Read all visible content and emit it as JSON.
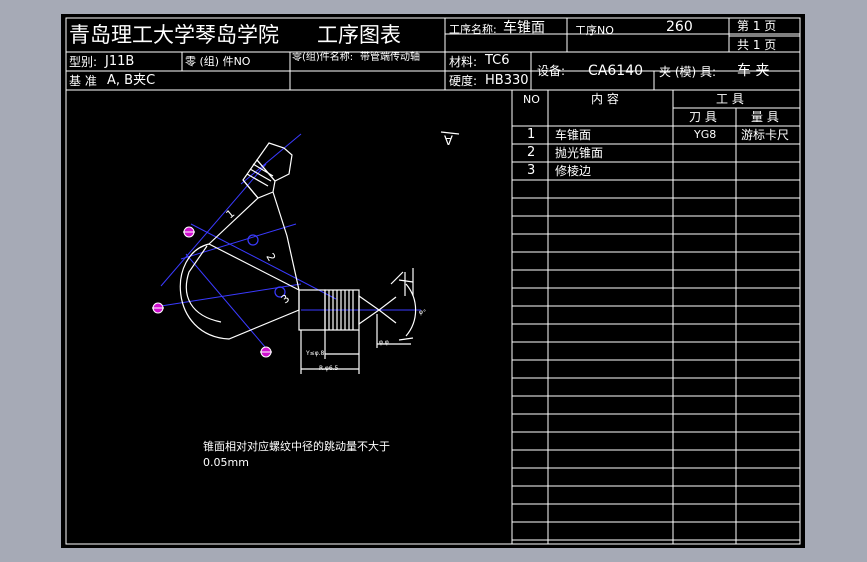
{
  "title_block": {
    "school": "青岛理工大学琴岛学院",
    "doc_title": "工序图表",
    "process_name_label": "工序名称:",
    "process_name_value": "车锥面",
    "process_no_label": "工序NO",
    "process_no_value": "260",
    "page_label": "第 1 页",
    "total_label": "共 1 页",
    "model_label": "型别:",
    "model_value": "J11B",
    "part_no_label": "零 (组) 件NO",
    "part_name_label": "零(组)件名称:",
    "part_name_value": "带管端传动轴",
    "material_label": "材料:",
    "material_value": "TC6",
    "equipment_label": "设备:",
    "equipment_value": "CA6140",
    "fixture_label": "夹 (模) 具:",
    "fixture_value": "车 夹",
    "datum_label": "基 准",
    "datum_value": "A, B夹C",
    "hardness_label": "硬度:",
    "hardness_value": "HB330"
  },
  "table": {
    "col_no": "NO",
    "col_content": "内  容",
    "col_tools": "工  具",
    "col_cutter": "刀 具",
    "col_gauge": "量 具",
    "rows": [
      {
        "no": "1",
        "content": "车锥面",
        "cutter": "YG8",
        "gauge": "游标卡尺"
      },
      {
        "no": "2",
        "content": "抛光锥面",
        "cutter": "",
        "gauge": ""
      },
      {
        "no": "3",
        "content": "修棱边",
        "cutter": "",
        "gauge": ""
      }
    ]
  },
  "drawing": {
    "surface_symbol": "∀",
    "tri_label_1": "1",
    "tri_label_2": "2",
    "tri_label_3": "3",
    "dim_label_1": "Y≤φ.8",
    "dim_label_2": "R.φ6.5",
    "dim_label_3": "φ.φ",
    "angle_label": "φ°"
  },
  "note": {
    "line1": "锥面相对对应螺纹中径的跳动量不大于",
    "line2": "0.05mm"
  },
  "colors": {
    "line": "#ffffff",
    "center_line": "#3a3aff",
    "marker": "#d010d0",
    "background": "#000000",
    "outer": "#a6aab6"
  }
}
